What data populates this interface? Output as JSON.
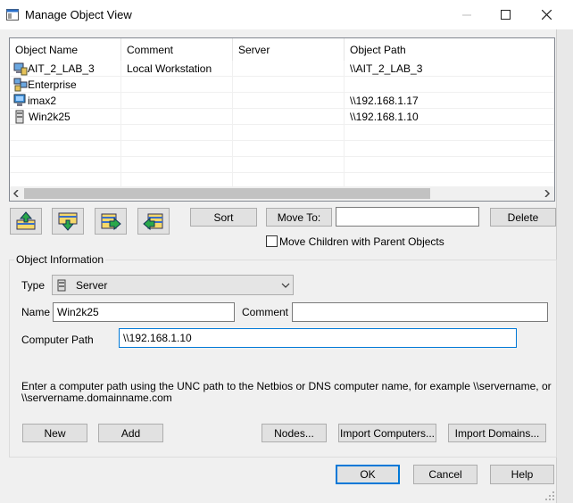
{
  "window": {
    "title": "Manage Object View"
  },
  "list": {
    "columns": [
      "Object Name",
      "Comment",
      "Server",
      "Object Path"
    ],
    "rows": [
      {
        "name": "AIT_2_LAB_3",
        "comment": "Local Workstation",
        "server": "",
        "path": "\\\\AIT_2_LAB_3",
        "icon": "workstation-icon"
      },
      {
        "name": "Enterprise",
        "comment": "",
        "server": "",
        "path": "",
        "icon": "enterprise-icon"
      },
      {
        "name": "imax2",
        "comment": "",
        "server": "",
        "path": "\\\\192.168.1.17",
        "icon": "computer-icon"
      },
      {
        "name": "Win2k25",
        "comment": "",
        "server": "",
        "path": "\\\\192.168.1.10",
        "icon": "server-icon"
      }
    ]
  },
  "toolbar": {
    "sort_label": "Sort",
    "move_to_label": "Move To:",
    "move_to_value": "",
    "delete_label": "Delete",
    "move_children_label": "Move Children with Parent Objects",
    "move_children_checked": false
  },
  "info": {
    "group_label": "Object Information",
    "type_label": "Type",
    "type_value": "Server",
    "name_label": "Name",
    "name_value": "Win2k25",
    "comment_label": "Comment",
    "comment_value": "",
    "path_label": "Computer Path",
    "path_value": "\\\\192.168.1.10",
    "hint_line1": "Enter a computer path using the UNC path to the Netbios or DNS computer name, for example \\\\servername, or",
    "hint_line2": "\\\\servername.domainname.com",
    "new_label": "New",
    "add_label": "Add",
    "nodes_label": "Nodes...",
    "import_computers_label": "Import Computers...",
    "import_domains_label": "Import Domains..."
  },
  "footer": {
    "ok_label": "OK",
    "cancel_label": "Cancel",
    "help_label": "Help"
  },
  "colors": {
    "accent": "#0078d7"
  }
}
